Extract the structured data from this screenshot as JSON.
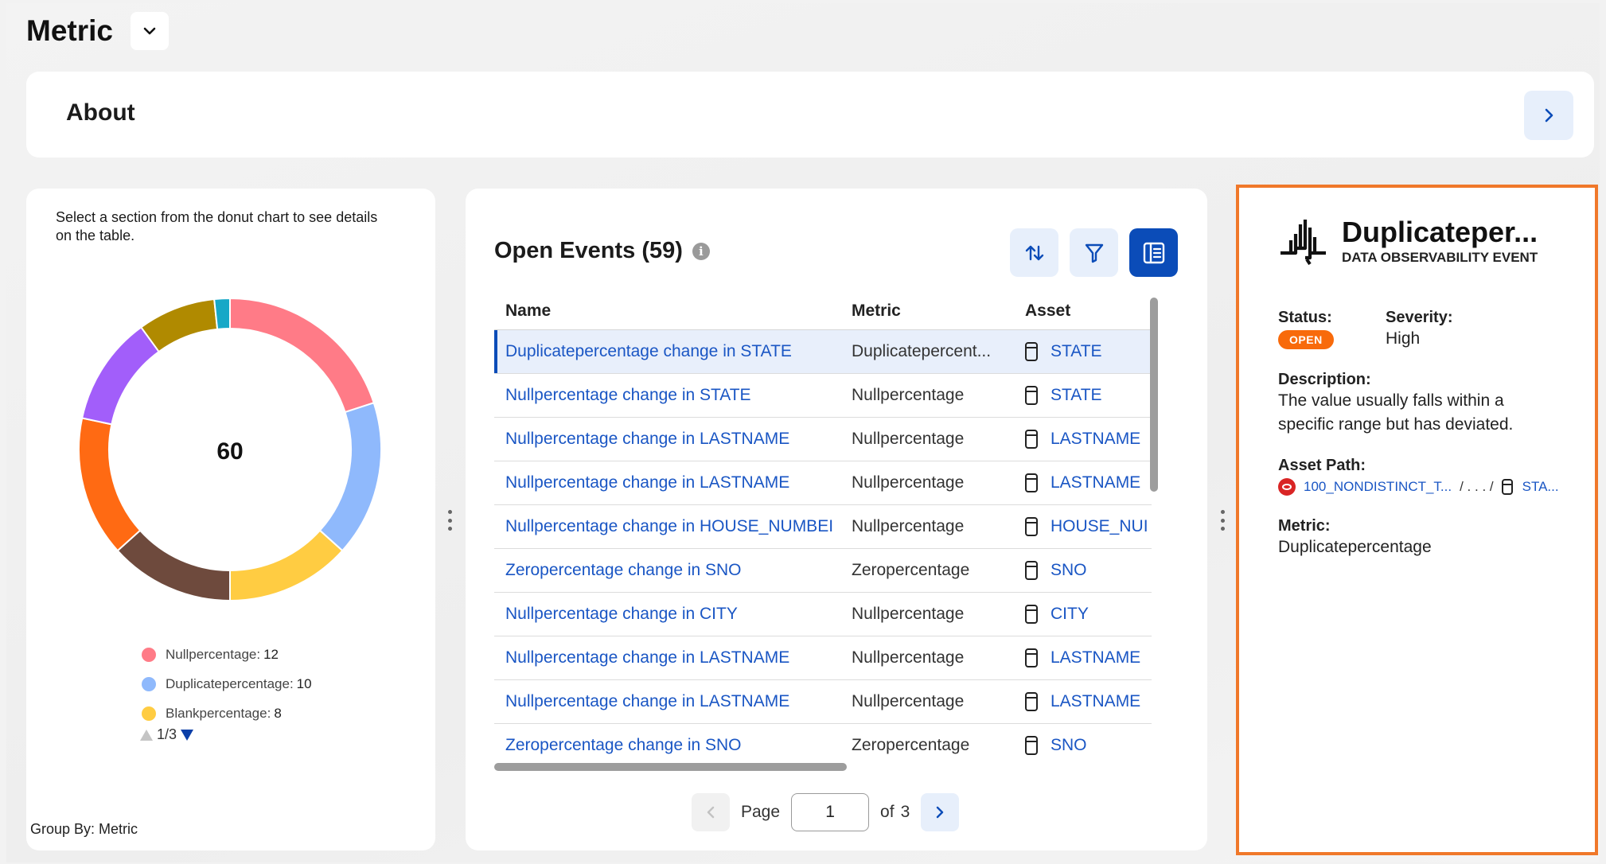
{
  "header": {
    "title": "Metric"
  },
  "about": {
    "title": "About"
  },
  "chart_panel": {
    "hint": "Select a section from the donut chart to see details on the table.",
    "group_by": "Group By: Metric",
    "legend_page": "1/3",
    "legend": [
      {
        "label": "Nullpercentage:",
        "value": "12",
        "color": "#ff7b87"
      },
      {
        "label": "Duplicatepercentage:",
        "value": "10",
        "color": "#8fb9fc"
      },
      {
        "label": "Blankpercentage:",
        "value": "8",
        "color": "#ffcc42"
      }
    ]
  },
  "chart_data": {
    "type": "pie",
    "center_label": "60",
    "total": 60,
    "slices": [
      {
        "name": "Nullpercentage",
        "value": 12,
        "color": "#ff7b87"
      },
      {
        "name": "Duplicatepercentage",
        "value": 10,
        "color": "#8fb9fc"
      },
      {
        "name": "Blankpercentage",
        "value": 8,
        "color": "#ffcc42"
      },
      {
        "value": 8,
        "color": "#6e4a3d"
      },
      {
        "value": 9,
        "color": "#ff6a13"
      },
      {
        "value": 7,
        "color": "#a25efa"
      },
      {
        "value": 5,
        "color": "#b08a00"
      },
      {
        "value": 1,
        "color": "#17a8c7"
      }
    ]
  },
  "events": {
    "title": "Open Events (59)",
    "columns": [
      "Name",
      "Metric",
      "Asset"
    ],
    "rows": [
      {
        "name": "Duplicatepercentage change in STATE",
        "metric": "Duplicatepercent...",
        "asset": "STATE",
        "selected": true
      },
      {
        "name": "Nullpercentage change in STATE",
        "metric": "Nullpercentage",
        "asset": "STATE"
      },
      {
        "name": "Nullpercentage change in LASTNAME",
        "metric": "Nullpercentage",
        "asset": "LASTNAME"
      },
      {
        "name": "Nullpercentage change in LASTNAME",
        "metric": "Nullpercentage",
        "asset": "LASTNAME"
      },
      {
        "name": "Nullpercentage change in HOUSE_NUMBEI",
        "metric": "Nullpercentage",
        "asset": "HOUSE_NUI"
      },
      {
        "name": "Zeropercentage change in SNO",
        "metric": "Zeropercentage",
        "asset": "SNO"
      },
      {
        "name": "Nullpercentage change in CITY",
        "metric": "Nullpercentage",
        "asset": "CITY"
      },
      {
        "name": "Nullpercentage change in LASTNAME",
        "metric": "Nullpercentage",
        "asset": "LASTNAME"
      },
      {
        "name": "Nullpercentage change in LASTNAME",
        "metric": "Nullpercentage",
        "asset": "LASTNAME"
      },
      {
        "name": "Zeropercentage change in SNO",
        "metric": "Zeropercentage",
        "asset": "SNO"
      }
    ],
    "pager": {
      "page_label": "Page",
      "page_value": "1",
      "of_label": "of",
      "total_pages": "3"
    }
  },
  "detail": {
    "title": "Duplicateper...",
    "subtitle": "DATA OBSERVABILITY EVENT",
    "status_label": "Status:",
    "status_value": "OPEN",
    "severity_label": "Severity:",
    "severity_value": "High",
    "description_label": "Description:",
    "description_value": "The value usually falls within a specific range but has deviated.",
    "asset_path_label": "Asset Path:",
    "asset_path_source": "100_NONDISTINCT_T...",
    "asset_path_middle": "/ . . . /",
    "asset_path_target": "STA...",
    "metric_label": "Metric:",
    "metric_value": "Duplicatepercentage"
  },
  "colors": {
    "accent": "#0b4cb8",
    "link": "#1a56c4",
    "highlight_border": "#f0782a",
    "status_open": "#f86a0b"
  }
}
